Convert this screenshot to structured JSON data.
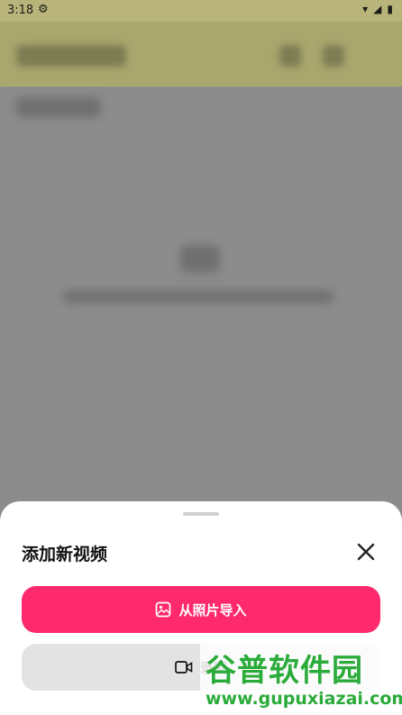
{
  "status_bar": {
    "time": "3:18"
  },
  "sheet": {
    "title": "添加新视频",
    "import_label": "从照片导入",
    "record_label": "录制"
  },
  "watermark": {
    "title": "谷普软件园",
    "url": "www.gupuxiazai.com"
  },
  "colors": {
    "accent": "#ff2a6e",
    "secondary_button": "#e3e3e3",
    "overlay": "#8c8c8c",
    "watermark_green": "#2bab3a"
  }
}
